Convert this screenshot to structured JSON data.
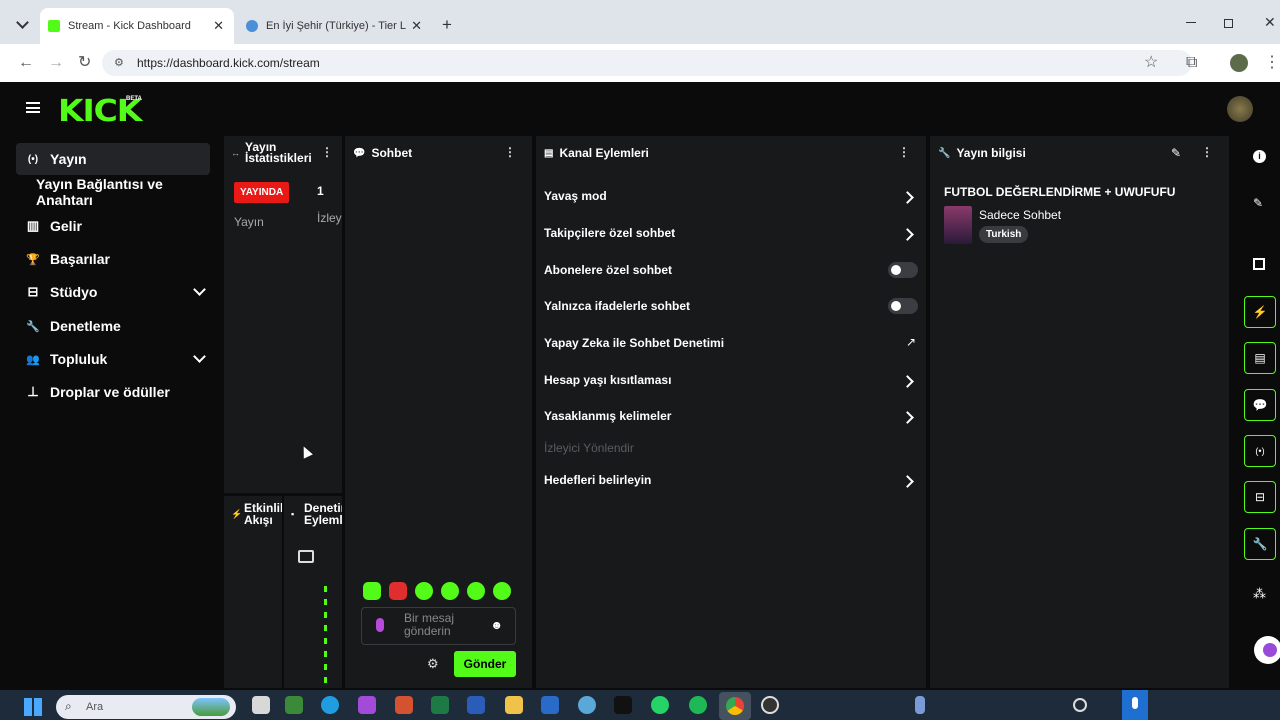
{
  "browser": {
    "tabs": [
      {
        "title": "Stream - Kick Dashboard",
        "active": true
      },
      {
        "title": "En İyi Şehir (Türkiye) - Tier List |",
        "active": false
      }
    ],
    "url": "https://dashboard.kick.com/stream"
  },
  "app": {
    "logo": "KICK",
    "beta": "BETA",
    "sidebar": [
      {
        "label": "Yayın",
        "icon": "broadcast-icon",
        "glyph": "(•)"
      },
      {
        "label": "Yayın Bağlantısı ve Anahtarı",
        "icon": "",
        "glyph": ""
      },
      {
        "label": "Gelir",
        "icon": "chart-icon",
        "glyph": "▥"
      },
      {
        "label": "Başarılar",
        "icon": "trophy-icon",
        "glyph": "🏆"
      },
      {
        "label": "Stüdyo",
        "icon": "studio-icon",
        "glyph": "⊟"
      },
      {
        "label": "Denetleme",
        "icon": "wrench-icon",
        "glyph": "🔧"
      },
      {
        "label": "Topluluk",
        "icon": "community-icon",
        "glyph": "👥"
      },
      {
        "label": "Droplar ve ödüller",
        "icon": "drops-icon",
        "glyph": "⊥"
      }
    ],
    "stats": {
      "title": "Yayın İstatistikleri",
      "badge": "YAYINDA",
      "badge_sub": "Yayın",
      "count": "1",
      "count_sub": "İzley"
    },
    "activity": {
      "title": "Etkinlik Akışı"
    },
    "moderation": {
      "title": "Denetim Eylemleri"
    },
    "chat": {
      "title": "Sohbet",
      "placeholder": "Bir mesaj gönderin",
      "send": "Gönder"
    },
    "channel_actions": {
      "title": "Kanal Eylemleri",
      "items": [
        {
          "label": "Yavaş mod",
          "control": "arrow"
        },
        {
          "label": "Takipçilere özel sohbet",
          "control": "arrow"
        },
        {
          "label": "Abonelere özel sohbet",
          "control": "toggle"
        },
        {
          "label": "Yalnızca ifadelerle sohbet",
          "control": "toggle"
        },
        {
          "label": "Yapay Zeka ile Sohbet Denetimi",
          "control": "external"
        },
        {
          "label": "Hesap yaşı kısıtlaması",
          "control": "arrow"
        },
        {
          "label": "Yasaklanmış kelimeler",
          "control": "arrow"
        },
        {
          "label": "İzleyici Yönlendir",
          "control": "none"
        },
        {
          "label": "Hedefleri belirleyin",
          "control": "arrow"
        }
      ]
    },
    "stream_info": {
      "title": "Yayın bilgisi",
      "stream_title": "FUTBOL DEĞERLENDİRME + UWUFUFU",
      "category": "Sadece Sohbet",
      "tag": "Turkish"
    }
  },
  "taskbar": {
    "search": "Ara"
  },
  "colors": {
    "accent": "#53fc18",
    "live": "#e91916",
    "panel": "#18191b",
    "background": "#0b0b0c"
  }
}
